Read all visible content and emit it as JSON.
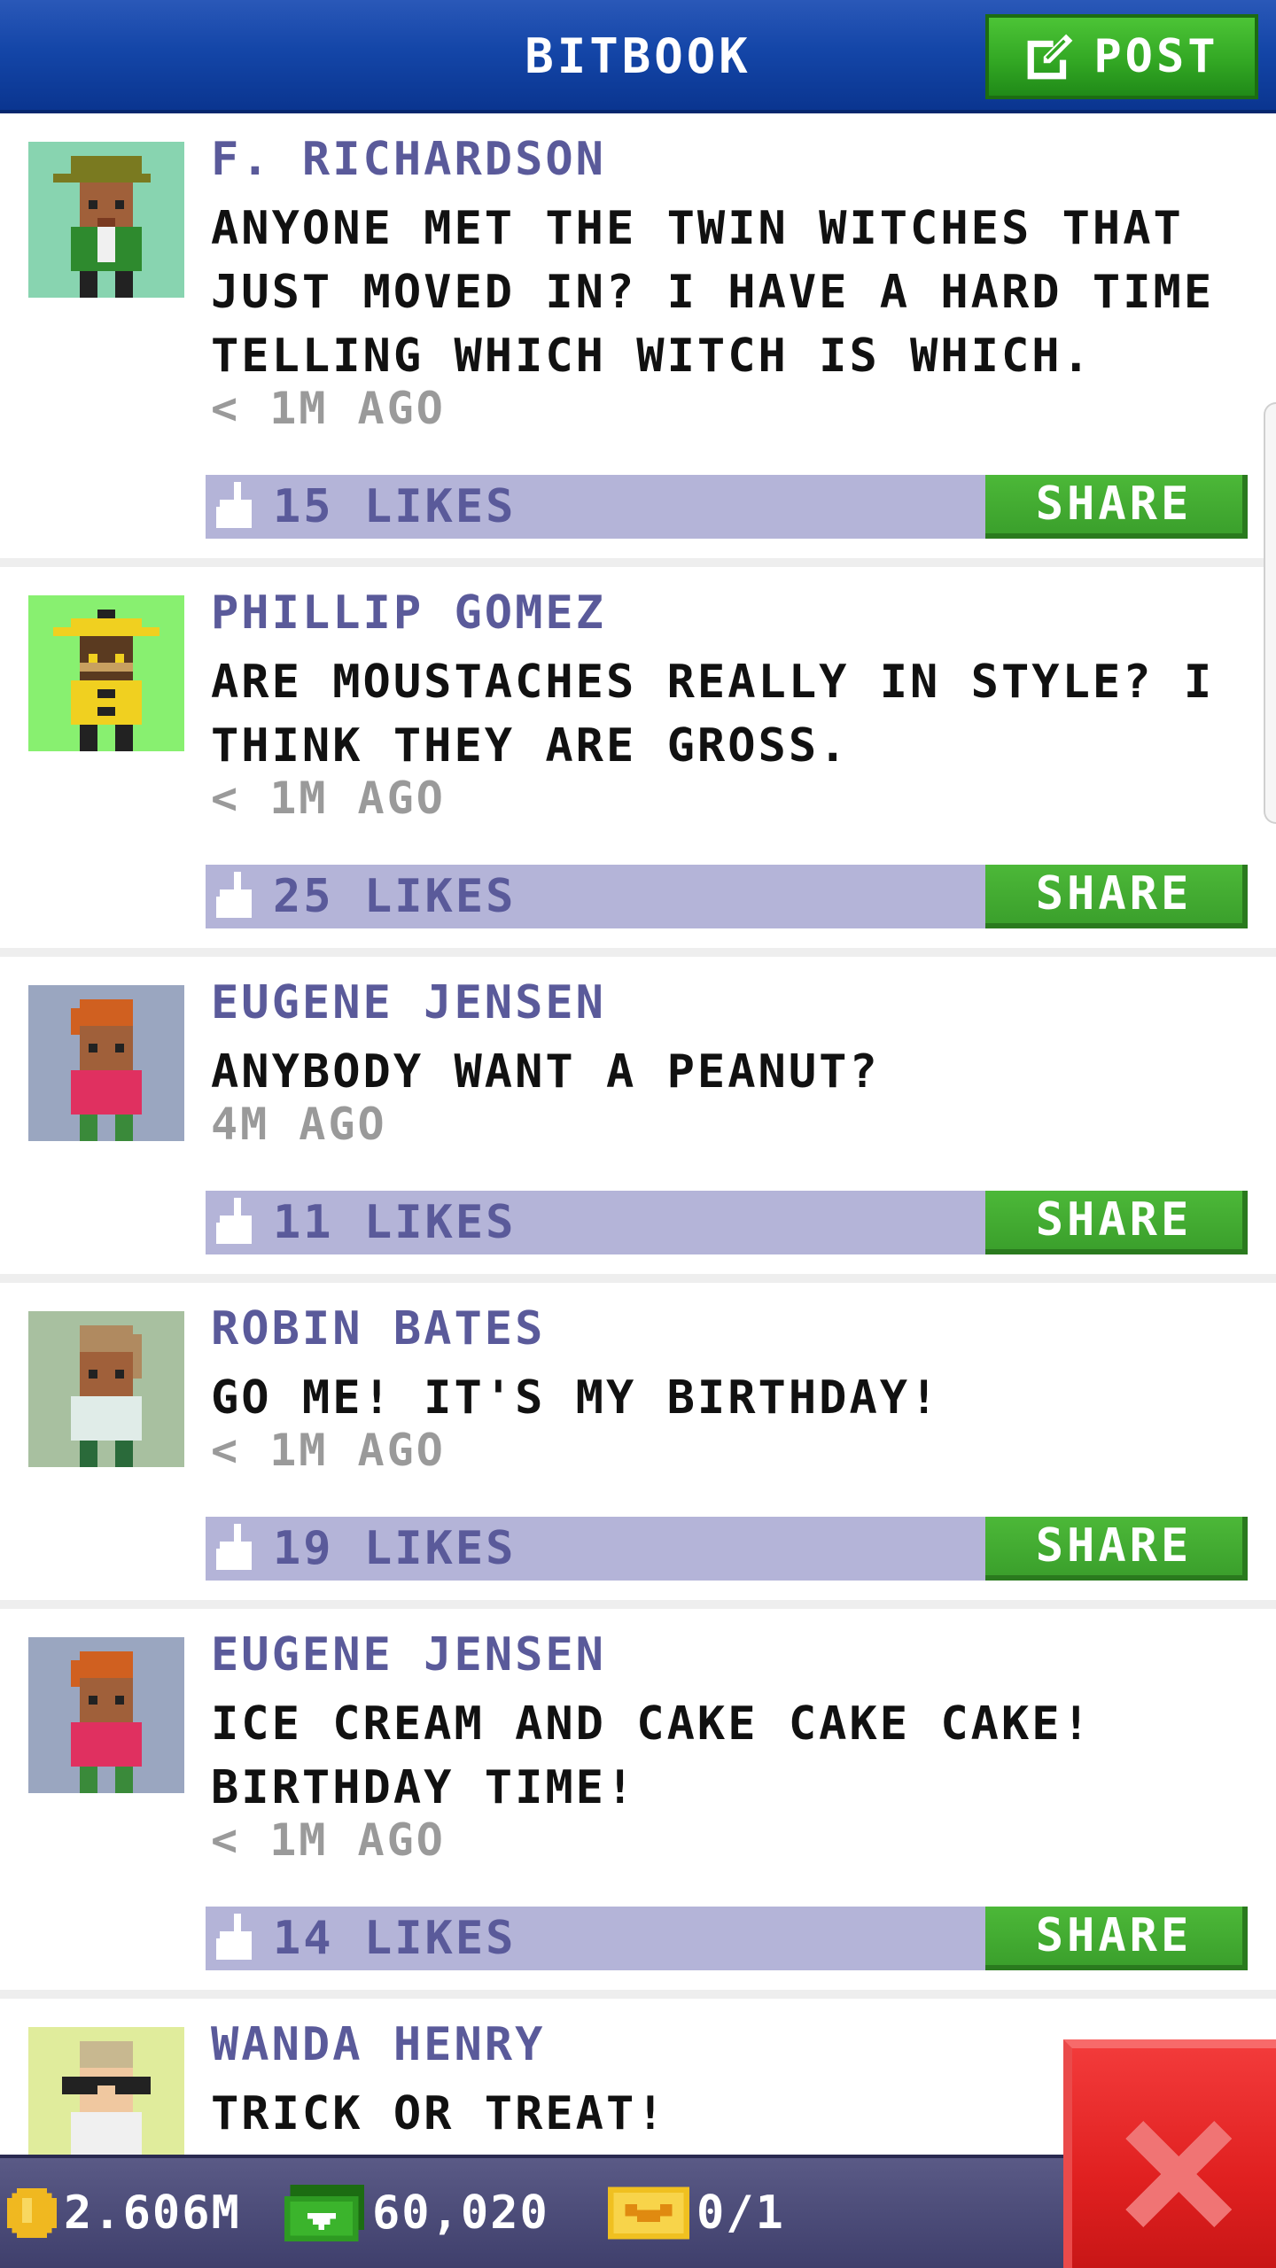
{
  "header": {
    "title": "BITBOOK",
    "post_label": "POST"
  },
  "colors": {
    "header_blue": "#1446a8",
    "accent_green": "#3ba02c",
    "likes_bar": "#b4b4d8",
    "author_purple": "#5a5a9a",
    "close_red": "#e02020",
    "status_bar": "#4a4a78"
  },
  "posts": [
    {
      "author": "F. RICHARDSON",
      "message": "ANYONE MET THE TWIN WITCHES THAT\nJUST MOVED IN? I HAVE A HARD TIME\nTELLING WHICH WITCH IS WHICH.",
      "time": "< 1M AGO",
      "likes": "15 LIKES",
      "share_label": "SHARE",
      "avatar_bg": "#88d4b0"
    },
    {
      "author": "PHILLIP GOMEZ",
      "message": "ARE MOUSTACHES REALLY IN STYLE? I\nTHINK THEY ARE GROSS.",
      "time": "< 1M AGO",
      "likes": "25 LIKES",
      "share_label": "SHARE",
      "avatar_bg": "#88f070"
    },
    {
      "author": "EUGENE JENSEN",
      "message": "ANYBODY WANT A PEANUT?",
      "time": "4M AGO",
      "likes": "11 LIKES",
      "share_label": "SHARE",
      "avatar_bg": "#9aa6c0"
    },
    {
      "author": "ROBIN BATES",
      "message": "GO ME! IT'S MY BIRTHDAY!",
      "time": "< 1M AGO",
      "likes": "19 LIKES",
      "share_label": "SHARE",
      "avatar_bg": "#a8c0a0"
    },
    {
      "author": "EUGENE JENSEN",
      "message": "ICE CREAM AND CAKE CAKE CAKE!\nBIRTHDAY TIME!",
      "time": "< 1M AGO",
      "likes": "14 LIKES",
      "share_label": "SHARE",
      "avatar_bg": "#9aa6c0"
    },
    {
      "author": "WANDA HENRY",
      "message": "TRICK OR TREAT!",
      "avatar_bg": "#e0ec9c"
    }
  ],
  "status": {
    "coins": "2.606M",
    "bux": "60,020",
    "tickets": "0/1"
  },
  "icons": {
    "post": "edit-icon",
    "like": "thumbs-up-icon",
    "coin": "coin-icon",
    "bux": "bux-icon",
    "ticket": "ticket-icon",
    "close": "close-icon"
  }
}
